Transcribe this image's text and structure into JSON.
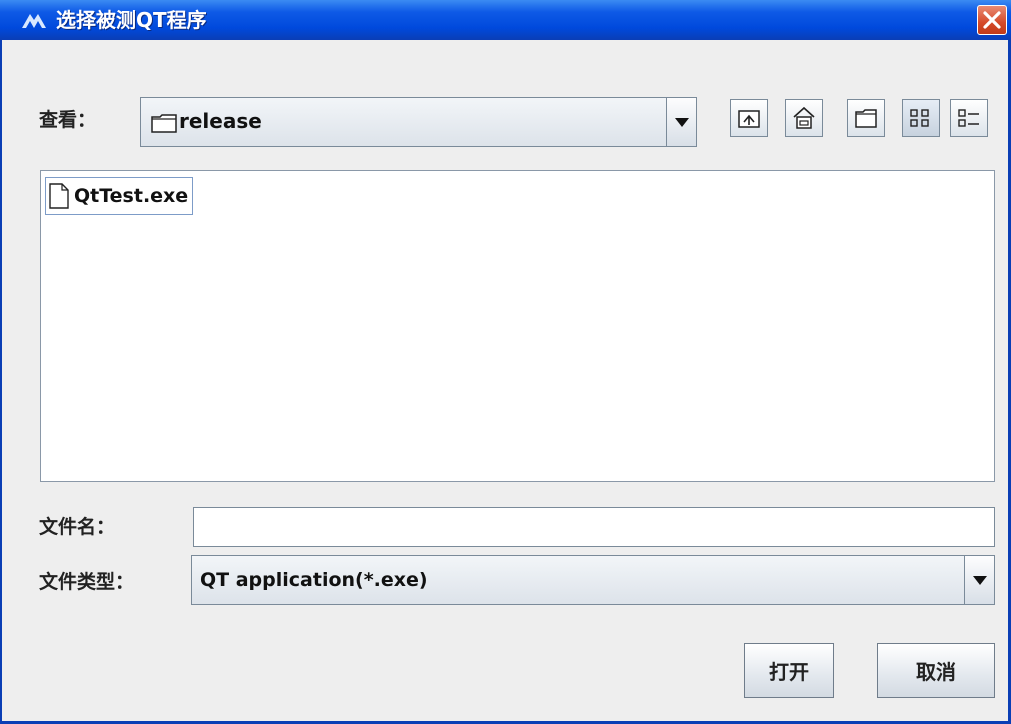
{
  "window": {
    "title": "选择被测QT程序"
  },
  "lookin": {
    "label": "查看：",
    "value": "release"
  },
  "toolbar": [
    "up-folder",
    "home",
    "new-folder",
    "list-view",
    "details-view"
  ],
  "files": [
    {
      "name": "QtTest.exe",
      "icon": "file-icon"
    }
  ],
  "filename": {
    "label": "文件名：",
    "value": ""
  },
  "filetype": {
    "label": "文件类型：",
    "value": "QT application(*.exe)"
  },
  "buttons": {
    "open": "打开",
    "cancel": "取消"
  },
  "colors": {
    "titlebar": "#0A3EB5",
    "close": "#D54A2A",
    "background": "#EEEEEE"
  }
}
